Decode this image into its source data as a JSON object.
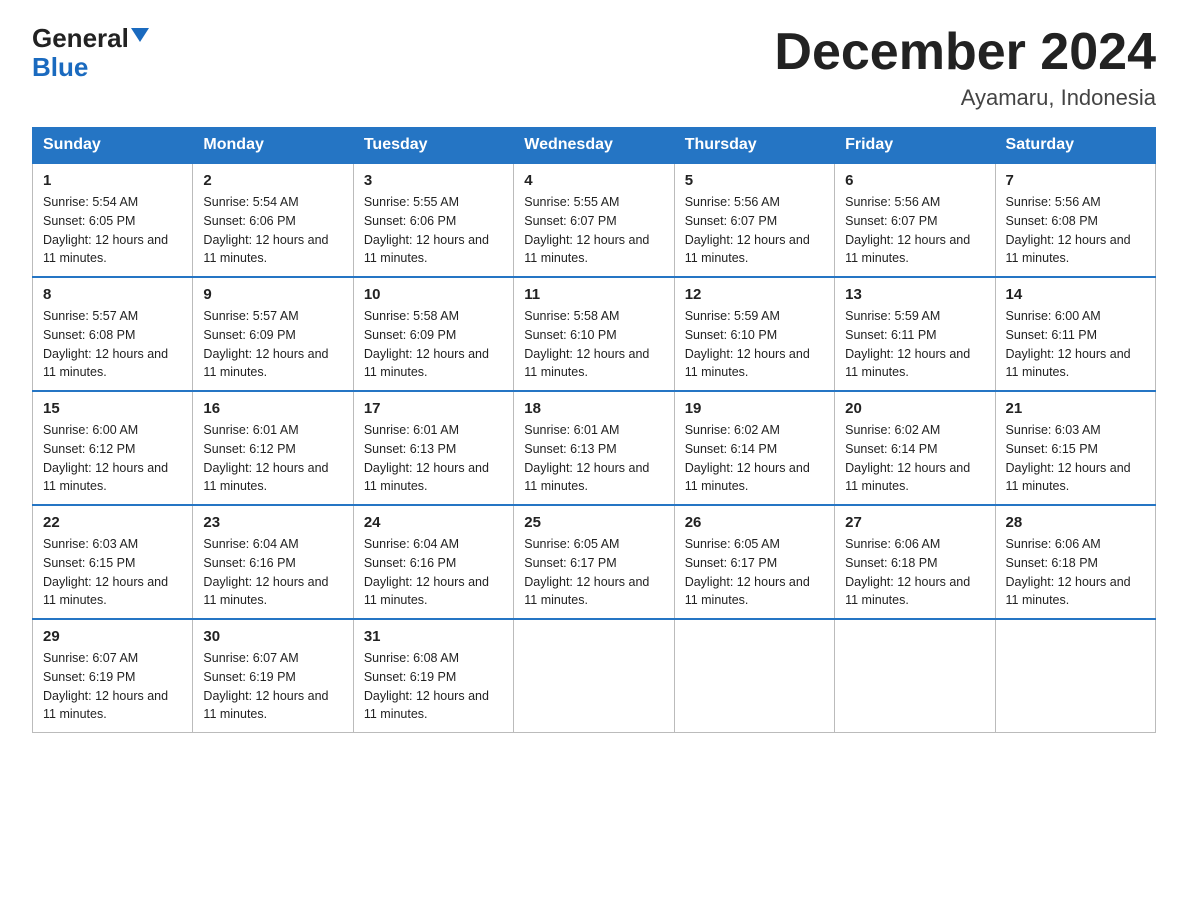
{
  "logo": {
    "general": "General",
    "blue": "Blue"
  },
  "header": {
    "title": "December 2024",
    "subtitle": "Ayamaru, Indonesia"
  },
  "weekdays": [
    "Sunday",
    "Monday",
    "Tuesday",
    "Wednesday",
    "Thursday",
    "Friday",
    "Saturday"
  ],
  "weeks": [
    [
      {
        "day": "1",
        "sunrise": "5:54 AM",
        "sunset": "6:05 PM",
        "daylight": "12 hours and 11 minutes."
      },
      {
        "day": "2",
        "sunrise": "5:54 AM",
        "sunset": "6:06 PM",
        "daylight": "12 hours and 11 minutes."
      },
      {
        "day": "3",
        "sunrise": "5:55 AM",
        "sunset": "6:06 PM",
        "daylight": "12 hours and 11 minutes."
      },
      {
        "day": "4",
        "sunrise": "5:55 AM",
        "sunset": "6:07 PM",
        "daylight": "12 hours and 11 minutes."
      },
      {
        "day": "5",
        "sunrise": "5:56 AM",
        "sunset": "6:07 PM",
        "daylight": "12 hours and 11 minutes."
      },
      {
        "day": "6",
        "sunrise": "5:56 AM",
        "sunset": "6:07 PM",
        "daylight": "12 hours and 11 minutes."
      },
      {
        "day": "7",
        "sunrise": "5:56 AM",
        "sunset": "6:08 PM",
        "daylight": "12 hours and 11 minutes."
      }
    ],
    [
      {
        "day": "8",
        "sunrise": "5:57 AM",
        "sunset": "6:08 PM",
        "daylight": "12 hours and 11 minutes."
      },
      {
        "day": "9",
        "sunrise": "5:57 AM",
        "sunset": "6:09 PM",
        "daylight": "12 hours and 11 minutes."
      },
      {
        "day": "10",
        "sunrise": "5:58 AM",
        "sunset": "6:09 PM",
        "daylight": "12 hours and 11 minutes."
      },
      {
        "day": "11",
        "sunrise": "5:58 AM",
        "sunset": "6:10 PM",
        "daylight": "12 hours and 11 minutes."
      },
      {
        "day": "12",
        "sunrise": "5:59 AM",
        "sunset": "6:10 PM",
        "daylight": "12 hours and 11 minutes."
      },
      {
        "day": "13",
        "sunrise": "5:59 AM",
        "sunset": "6:11 PM",
        "daylight": "12 hours and 11 minutes."
      },
      {
        "day": "14",
        "sunrise": "6:00 AM",
        "sunset": "6:11 PM",
        "daylight": "12 hours and 11 minutes."
      }
    ],
    [
      {
        "day": "15",
        "sunrise": "6:00 AM",
        "sunset": "6:12 PM",
        "daylight": "12 hours and 11 minutes."
      },
      {
        "day": "16",
        "sunrise": "6:01 AM",
        "sunset": "6:12 PM",
        "daylight": "12 hours and 11 minutes."
      },
      {
        "day": "17",
        "sunrise": "6:01 AM",
        "sunset": "6:13 PM",
        "daylight": "12 hours and 11 minutes."
      },
      {
        "day": "18",
        "sunrise": "6:01 AM",
        "sunset": "6:13 PM",
        "daylight": "12 hours and 11 minutes."
      },
      {
        "day": "19",
        "sunrise": "6:02 AM",
        "sunset": "6:14 PM",
        "daylight": "12 hours and 11 minutes."
      },
      {
        "day": "20",
        "sunrise": "6:02 AM",
        "sunset": "6:14 PM",
        "daylight": "12 hours and 11 minutes."
      },
      {
        "day": "21",
        "sunrise": "6:03 AM",
        "sunset": "6:15 PM",
        "daylight": "12 hours and 11 minutes."
      }
    ],
    [
      {
        "day": "22",
        "sunrise": "6:03 AM",
        "sunset": "6:15 PM",
        "daylight": "12 hours and 11 minutes."
      },
      {
        "day": "23",
        "sunrise": "6:04 AM",
        "sunset": "6:16 PM",
        "daylight": "12 hours and 11 minutes."
      },
      {
        "day": "24",
        "sunrise": "6:04 AM",
        "sunset": "6:16 PM",
        "daylight": "12 hours and 11 minutes."
      },
      {
        "day": "25",
        "sunrise": "6:05 AM",
        "sunset": "6:17 PM",
        "daylight": "12 hours and 11 minutes."
      },
      {
        "day": "26",
        "sunrise": "6:05 AM",
        "sunset": "6:17 PM",
        "daylight": "12 hours and 11 minutes."
      },
      {
        "day": "27",
        "sunrise": "6:06 AM",
        "sunset": "6:18 PM",
        "daylight": "12 hours and 11 minutes."
      },
      {
        "day": "28",
        "sunrise": "6:06 AM",
        "sunset": "6:18 PM",
        "daylight": "12 hours and 11 minutes."
      }
    ],
    [
      {
        "day": "29",
        "sunrise": "6:07 AM",
        "sunset": "6:19 PM",
        "daylight": "12 hours and 11 minutes."
      },
      {
        "day": "30",
        "sunrise": "6:07 AM",
        "sunset": "6:19 PM",
        "daylight": "12 hours and 11 minutes."
      },
      {
        "day": "31",
        "sunrise": "6:08 AM",
        "sunset": "6:19 PM",
        "daylight": "12 hours and 11 minutes."
      },
      null,
      null,
      null,
      null
    ]
  ]
}
